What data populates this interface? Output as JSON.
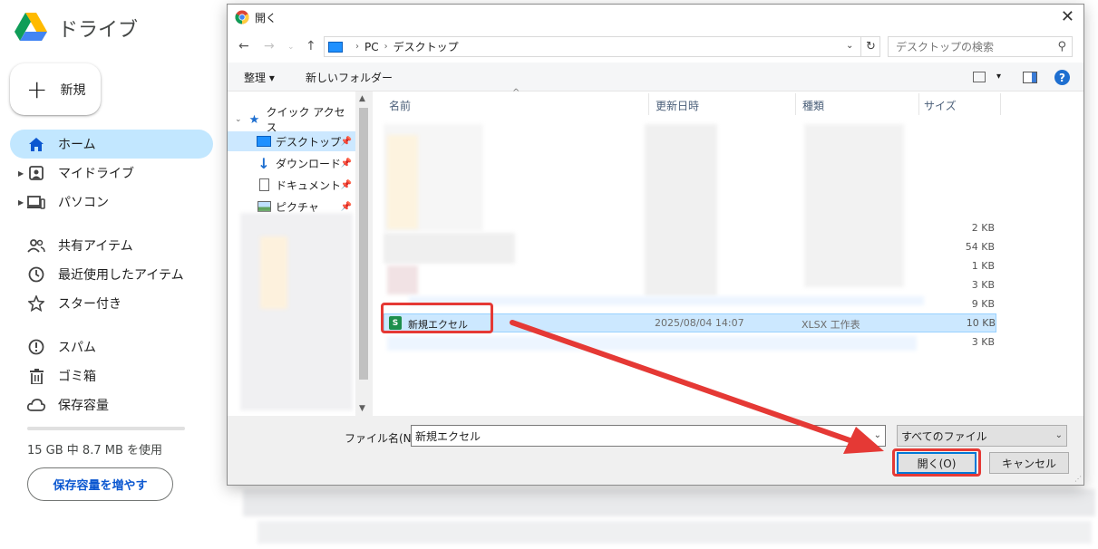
{
  "drive": {
    "title": "ドライブ",
    "new_label": "新規",
    "nav": [
      {
        "label": "ホーム",
        "icon": "home-icon",
        "active": true
      },
      {
        "label": "マイドライブ",
        "icon": "my-drive-icon"
      },
      {
        "label": "パソコン",
        "icon": "computers-icon"
      },
      {
        "label": "共有アイテム",
        "icon": "shared-icon"
      },
      {
        "label": "最近使用したアイテム",
        "icon": "recent-icon"
      },
      {
        "label": "スター付き",
        "icon": "star-icon"
      },
      {
        "label": "スパム",
        "icon": "spam-icon"
      },
      {
        "label": "ゴミ箱",
        "icon": "trash-icon"
      },
      {
        "label": "保存容量",
        "icon": "cloud-icon"
      }
    ],
    "storage_text": "15 GB 中 8.7 MB を使用",
    "storage_used_fraction": 0.0006,
    "storage_button": "保存容量を増やす"
  },
  "dialog": {
    "title": "開く",
    "breadcrumb": [
      "PC",
      "デスクトップ"
    ],
    "search_placeholder": "デスクトップの検索",
    "toolbar": {
      "organize": "整理 ▾",
      "new_folder": "新しいフォルダー"
    },
    "nav_pane": {
      "quick_access": "クイック アクセス",
      "items": [
        "デスクトップ",
        "ダウンロード",
        "ドキュメント",
        "ピクチャ"
      ]
    },
    "columns": {
      "name": "名前",
      "modified": "更新日時",
      "type": "種類",
      "size": "サイズ"
    },
    "sizes": [
      "2 KB",
      "54 KB",
      "1 KB",
      "3 KB",
      "9 KB"
    ],
    "selected_file": {
      "name": "新規エクセル",
      "modified": "2025/08/04 14:07",
      "type": "XLSX 工作表",
      "size": "10 KB"
    },
    "last_size": "3 KB",
    "file_name_label": "ファイル名(N):",
    "file_name_value": "新規エクセル",
    "file_type": "すべてのファイル",
    "open_button": "開く(O)",
    "cancel_button": "キャンセル"
  },
  "colors": {
    "selection": "#cce8ff",
    "highlight": "#e53935",
    "drive_active": "#c2e7ff"
  }
}
